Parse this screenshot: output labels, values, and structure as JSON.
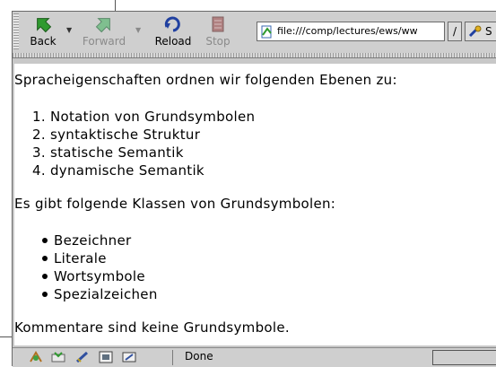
{
  "toolbar": {
    "back_label": "Back",
    "forward_label": "Forward",
    "reload_label": "Reload",
    "stop_label": "Stop",
    "address_value": "file:///comp/lectures/ews/ww",
    "search_label": "S"
  },
  "content": {
    "intro": "Spracheigenschaften ordnen wir folgenden Ebenen zu:",
    "levels": [
      "1. Notation von Grundsymbolen",
      "2. syntaktische Struktur",
      "3. statische Semantik",
      "4. dynamische Semantik"
    ],
    "classes_intro": "Es gibt folgende Klassen von Grundsymbolen:",
    "classes": [
      "Bezeichner",
      "Literale",
      "Wortsymbole",
      "Spezialzeichen"
    ],
    "comment_note": "Kommentare sind keine Grundsymbole."
  },
  "status": {
    "text": "Done"
  },
  "colors": {
    "toolbar_bg": "#cfcfcf",
    "content_bg": "#ffffff",
    "back_arrow": "#2f9a2f",
    "forward_arrow_disabled": "#7fbf8f",
    "reload_icon": "#2040a0",
    "stop_icon_disabled": "#b08080"
  },
  "icons": {
    "back": "back-arrow-icon",
    "forward": "forward-arrow-icon",
    "reload": "reload-icon",
    "stop": "stop-icon",
    "url": "page-file-icon",
    "search": "search-icon",
    "status_bar": [
      "mail-icon",
      "composer-icon",
      "address-book-icon",
      "news-icon",
      "security-icon"
    ]
  }
}
